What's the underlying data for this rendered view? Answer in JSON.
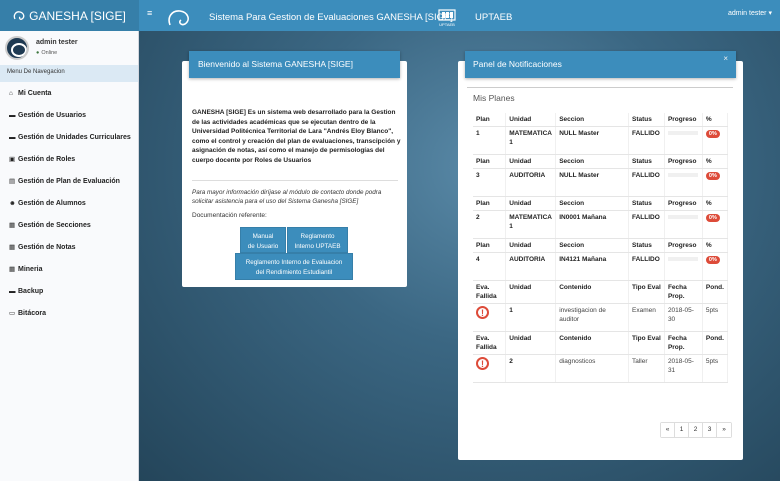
{
  "header": {
    "brand": "GANESHA [SIGE]",
    "toggle_icon": "≡",
    "system_title": "Sistema Para Gestion de Evaluaciones GANESHA [SIGE]",
    "uptaeb_logo_text": "UPTAEB",
    "uptaeb_label": "UPTAEB",
    "user_menu": "admin tester"
  },
  "sidebar": {
    "user_name": "admin tester",
    "user_status": "Online",
    "nav_header": "Menu De Navegacion",
    "items": [
      {
        "label": "Mi Cuenta",
        "icon": "home-icon",
        "glyph": "⌂"
      },
      {
        "label": "Gestión de Usuarios",
        "icon": "users-icon",
        "glyph": "▬"
      },
      {
        "label": "Gestión de Unidades Curriculares",
        "icon": "book-icon",
        "glyph": "▬"
      },
      {
        "label": "Gestión de Roles",
        "icon": "roles-icon",
        "glyph": "▣"
      },
      {
        "label": "Gestión de Plan de Evaluación",
        "icon": "plan-icon",
        "glyph": "▤"
      },
      {
        "label": "Gestión de Alumnos",
        "icon": "students-icon",
        "glyph": "☻"
      },
      {
        "label": "Gestión de Secciones",
        "icon": "sections-icon",
        "glyph": "▦"
      },
      {
        "label": "Gestión de Notas",
        "icon": "grades-icon",
        "glyph": "▦"
      },
      {
        "label": "Mineria",
        "icon": "mining-icon",
        "glyph": "▦"
      },
      {
        "label": "Backup",
        "icon": "backup-icon",
        "glyph": "▬"
      },
      {
        "label": "Bitácora",
        "icon": "log-icon",
        "glyph": "▭"
      }
    ]
  },
  "welcome": {
    "title": "Bienvenido al Sistema GANESHA [SIGE]",
    "description": "GANESHA [SIGE] Es un sistema web desarrollado para la Gestion de las actividades académicas que se ejecutan dentro de la Universidad Politécnica Territorial de Lara \"Andrés Eloy Blanco\", como el control y creación del plan de evaluaciones, transcipción y asignación de notas, así como el manejo de permisologías del cuerpo docente por Roles de Usuarios",
    "contact": "Para mayor información diríjase al módulo de contacto donde podra solicitar asistencia para el uso del Sistema Ganesha [SIGE]",
    "doc_label": "Documentación referente:",
    "buttons": [
      {
        "line1": "Manual",
        "line2": "de Usuario"
      },
      {
        "line1": "Reglamento",
        "line2": "Interno UPTAEB"
      },
      {
        "line1": "Reglamento Interno de Evaluacion",
        "line2": "del Rendimiento Estudiantil"
      }
    ]
  },
  "notifications": {
    "title": "Panel de Notificaciones",
    "close": "×",
    "section_title": "Mis Planes",
    "plan_headers": {
      "plan": "Plan",
      "unidad": "Unidad",
      "seccion": "Seccion",
      "status": "Status",
      "progreso": "Progreso",
      "pct": "%"
    },
    "plans": [
      {
        "plan": "1",
        "unidad": "MATEMATICA 1",
        "seccion": "NULL Master",
        "status": "FALLIDO",
        "progress": 0,
        "pct": "0%"
      },
      {
        "plan": "3",
        "unidad": "AUDITORIA",
        "seccion": "NULL Master",
        "status": "FALLIDO",
        "progress": 0,
        "pct": "0%"
      },
      {
        "plan": "2",
        "unidad": "MATEMATICA 1",
        "seccion": "IN0001 Mañana",
        "status": "FALLIDO",
        "progress": 0,
        "pct": "0%"
      },
      {
        "plan": "4",
        "unidad": "AUDITORIA",
        "seccion": "IN4121 Mañana",
        "status": "FALLIDO",
        "progress": 0,
        "pct": "0%"
      }
    ],
    "eval_headers": {
      "eva": "Eva. Fallida",
      "unidad": "Unidad",
      "contenido": "Contenido",
      "tipo": "Tipo Eval",
      "fecha": "Fecha Prop.",
      "pond": "Pond."
    },
    "evals": [
      {
        "warn": "!",
        "unidad": "1",
        "contenido": "investigacion de auditor",
        "tipo": "Examen",
        "fecha": "2018-05-30",
        "pond": "5pts"
      },
      {
        "warn": "!",
        "unidad": "2",
        "contenido": "diagnosticos",
        "tipo": "Taller",
        "fecha": "2018-05-31",
        "pond": "5pts"
      }
    ],
    "pager": [
      "«",
      "1",
      "2",
      "3",
      "»"
    ]
  }
}
